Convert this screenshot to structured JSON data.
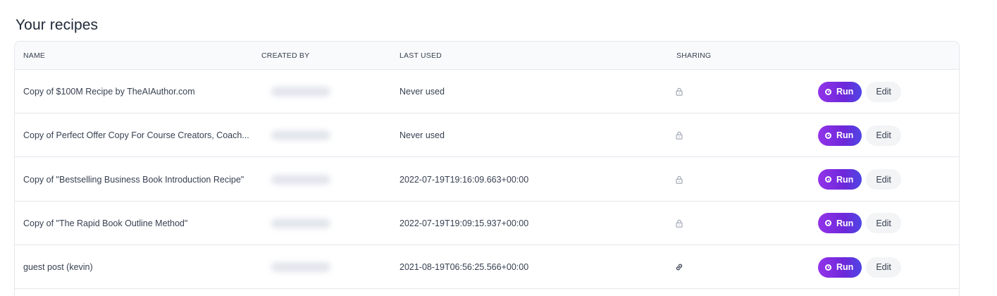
{
  "page": {
    "title": "Your recipes"
  },
  "table": {
    "headers": {
      "name": "NAME",
      "created_by": "CREATED BY",
      "last_used": "LAST USED",
      "sharing": "SHARING"
    },
    "rows": [
      {
        "name": "Copy of $100M Recipe by TheAIAuthor.com",
        "last_used": "Never used",
        "sharing_icon": "lock-icon",
        "run_label": "Run",
        "edit_label": "Edit"
      },
      {
        "name": "Copy of Perfect Offer Copy For Course Creators, Coach...",
        "last_used": "Never used",
        "sharing_icon": "lock-icon",
        "run_label": "Run",
        "edit_label": "Edit"
      },
      {
        "name": "Copy of \"Bestselling Business Book Introduction Recipe\"",
        "last_used": "2022-07-19T19:16:09.663+00:00",
        "sharing_icon": "lock-icon",
        "run_label": "Run",
        "edit_label": "Edit"
      },
      {
        "name": "Copy of \"The Rapid Book Outline Method\"",
        "last_used": "2022-07-19T19:09:15.937+00:00",
        "sharing_icon": "lock-icon",
        "run_label": "Run",
        "edit_label": "Edit"
      },
      {
        "name": "guest post (kevin)",
        "last_used": "2021-08-19T06:56:25.566+00:00",
        "sharing_icon": "link-icon",
        "run_label": "Run",
        "edit_label": "Edit"
      }
    ]
  },
  "colors": {
    "run_gradient_start": "#9333ea",
    "run_gradient_end": "#4f46e5",
    "edit_bg": "#f3f4f6",
    "header_bg": "#f9fafb",
    "border": "#e5e7eb"
  }
}
